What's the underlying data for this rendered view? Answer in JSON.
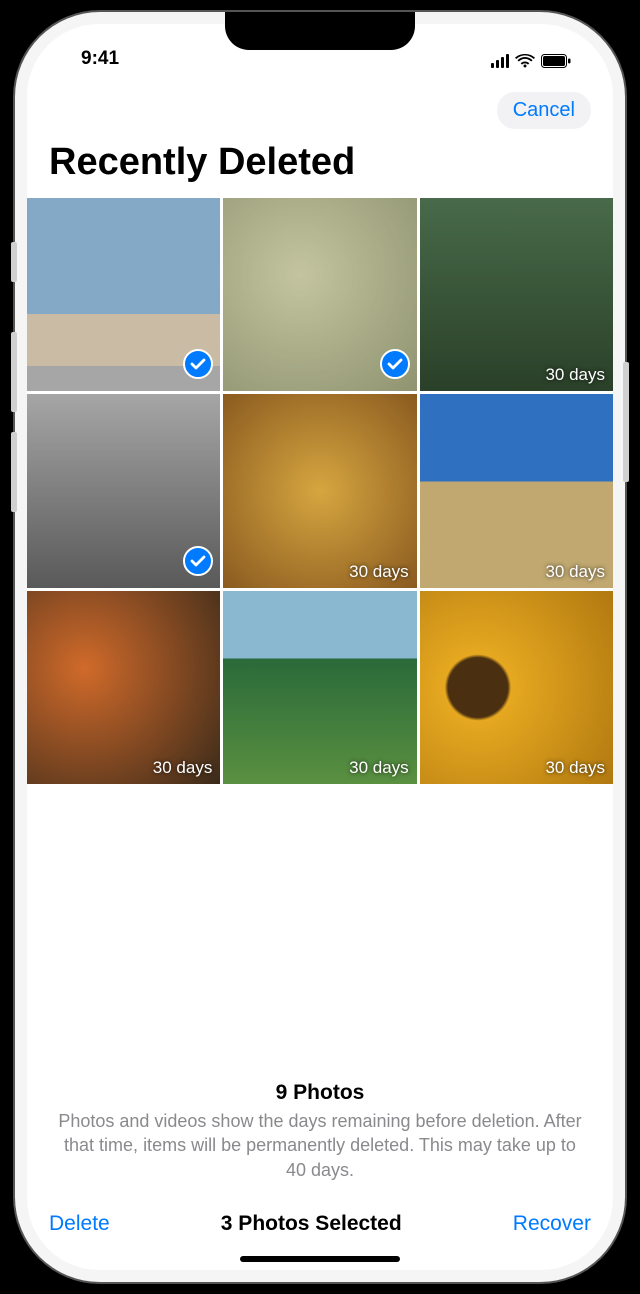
{
  "status": {
    "time": "9:41"
  },
  "nav": {
    "cancel": "Cancel"
  },
  "title": "Recently Deleted",
  "days_label": "30 days",
  "photos": [
    {
      "selected": true,
      "show_days": false
    },
    {
      "selected": true,
      "show_days": false
    },
    {
      "selected": false,
      "show_days": true
    },
    {
      "selected": true,
      "show_days": false
    },
    {
      "selected": false,
      "show_days": true
    },
    {
      "selected": false,
      "show_days": true
    },
    {
      "selected": false,
      "show_days": true
    },
    {
      "selected": false,
      "show_days": true
    },
    {
      "selected": false,
      "show_days": true
    }
  ],
  "summary": {
    "count": "9 Photos",
    "text": "Photos and videos show the days remaining before deletion. After that time, items will be permanently deleted. This may take up to 40 days."
  },
  "toolbar": {
    "delete": "Delete",
    "status": "3 Photos Selected",
    "recover": "Recover"
  },
  "colors": {
    "accent": "#007AFF"
  }
}
